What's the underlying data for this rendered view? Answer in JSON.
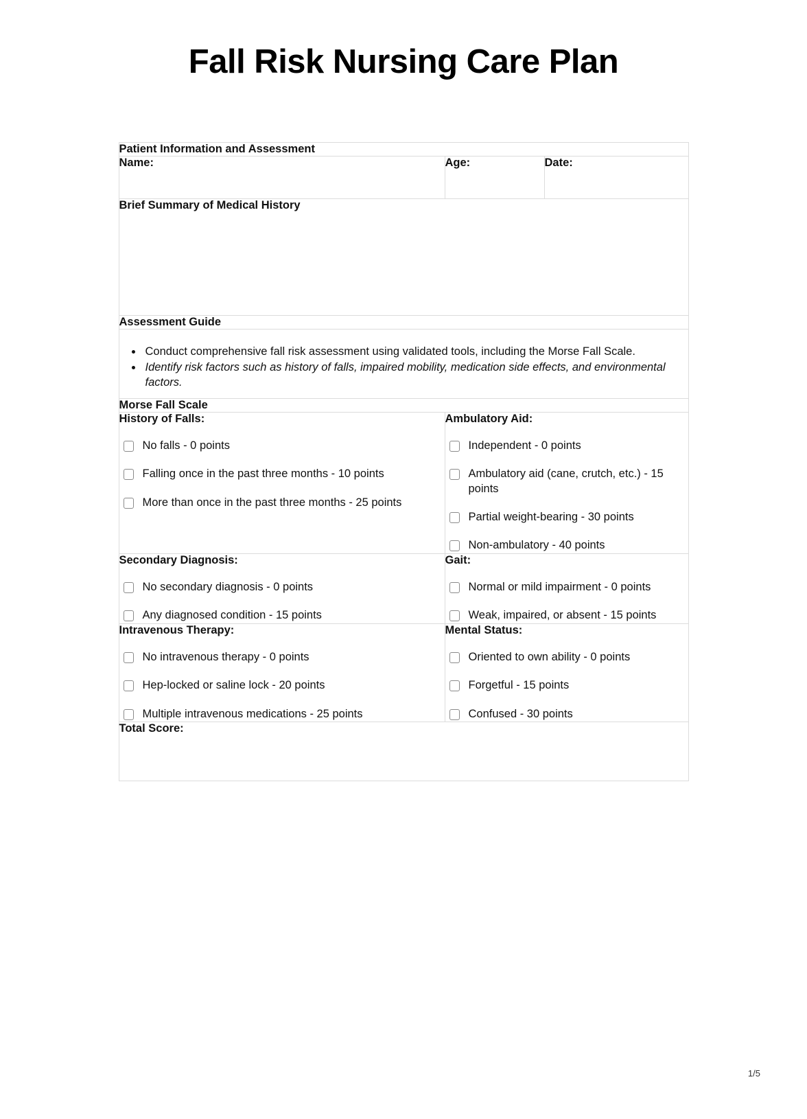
{
  "document": {
    "title": "Fall Risk Nursing Care Plan",
    "page_number": "1/5"
  },
  "patient_section": {
    "heading": "Patient Information and Assessment",
    "fields": {
      "name_label": "Name:",
      "age_label": "Age:",
      "date_label": "Date:"
    },
    "medical_history_heading": "Brief Summary of Medical History"
  },
  "assessment_guide": {
    "heading": "Assessment Guide",
    "bullets": [
      {
        "text": "Conduct comprehensive fall risk assessment using validated tools, including the Morse Fall Scale.",
        "italic": false
      },
      {
        "text": "Identify risk factors such as history of falls, impaired mobility, medication side effects, and environmental factors.",
        "italic": true
      }
    ]
  },
  "morse_fall_scale": {
    "heading": "Morse Fall Scale",
    "groups": [
      {
        "title": "History of Falls:",
        "options": [
          "No falls - 0 points",
          "Falling once in the past three months - 10 points",
          "More than once in the past three months - 25 points"
        ]
      },
      {
        "title": "Ambulatory Aid:",
        "options": [
          "Independent - 0 points",
          "Ambulatory aid (cane, crutch, etc.) - 15 points",
          "Partial weight-bearing - 30 points",
          "Non-ambulatory - 40 points"
        ]
      },
      {
        "title": "Secondary Diagnosis:",
        "options": [
          "No secondary diagnosis - 0 points",
          "Any diagnosed condition - 15 points"
        ]
      },
      {
        "title": "Gait:",
        "options": [
          "Normal or mild impairment - 0 points",
          "Weak, impaired, or absent - 15 points"
        ]
      },
      {
        "title": "Intravenous Therapy:",
        "options": [
          "No intravenous therapy - 0 points",
          "Hep-locked or saline lock - 20 points",
          "Multiple intravenous medications - 25 points"
        ]
      },
      {
        "title": "Mental Status:",
        "options": [
          "Oriented to own ability - 0 points",
          "Forgetful - 15 points",
          "Confused - 30 points"
        ]
      }
    ],
    "total_score_label": "Total Score:"
  }
}
